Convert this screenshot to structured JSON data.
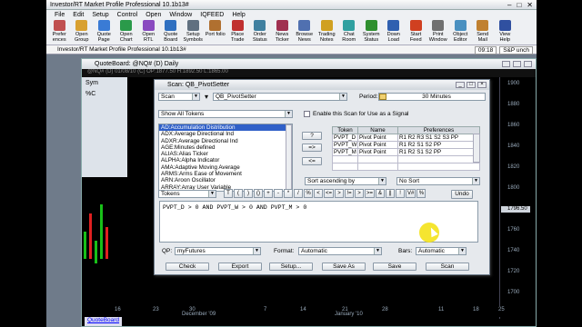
{
  "app": {
    "title": "Investor/RT Market Profile Professional 10.1b13#",
    "menu": [
      "File",
      "Edit",
      "Setup",
      "Control",
      "Open",
      "Window",
      "IQFEED",
      "Help"
    ],
    "toolbar": [
      {
        "label": "Prefer ences",
        "icon": "preferences-icon",
        "color": "#c05050"
      },
      {
        "label": "Open Group",
        "icon": "folder-icon",
        "color": "#d8a030"
      },
      {
        "label": "Quote Page",
        "icon": "quote-page-icon",
        "color": "#3a7bd5"
      },
      {
        "label": "Open Chart",
        "icon": "chart-icon",
        "color": "#2a9a4a"
      },
      {
        "label": "Open RTL",
        "icon": "rtl-icon",
        "color": "#8a4ac0"
      },
      {
        "label": "Quote Board",
        "icon": "quote-board-icon",
        "color": "#3070c0"
      },
      {
        "label": "Setup Symbols",
        "icon": "symbols-icon",
        "color": "#607080"
      },
      {
        "label": "Port folio",
        "icon": "portfolio-icon",
        "color": "#b07030"
      },
      {
        "label": "Place Trade",
        "icon": "trade-icon",
        "color": "#c03030"
      },
      {
        "label": "Order Status",
        "icon": "order-status-icon",
        "color": "#4080a0"
      },
      {
        "label": "News Ticker",
        "icon": "news-ticker-icon",
        "color": "#a03050"
      },
      {
        "label": "Browse News",
        "icon": "browse-news-icon",
        "color": "#5070b0"
      },
      {
        "label": "Trading Notes",
        "icon": "notes-icon",
        "color": "#d0a020"
      },
      {
        "label": "Chat Room",
        "icon": "chat-icon",
        "color": "#30a0a0"
      },
      {
        "label": "System Status",
        "icon": "system-status-icon",
        "color": "#2f8f2f"
      },
      {
        "label": "Down Load",
        "icon": "download-icon",
        "color": "#3060b0"
      },
      {
        "label": "Start Feed",
        "icon": "feed-icon",
        "color": "#d04020"
      },
      {
        "label": "Print Window",
        "icon": "print-icon",
        "color": "#707070"
      },
      {
        "label": "Object Editor",
        "icon": "object-editor-icon",
        "color": "#4a90c0"
      },
      {
        "label": "Send Mail",
        "icon": "mail-icon",
        "color": "#c08030"
      },
      {
        "label": "View Help",
        "icon": "help-icon",
        "color": "#3050a0"
      }
    ],
    "status": {
      "left": "Investor/RT Market Profile Professional 10.1b13#",
      "time": "09:18",
      "feed": "S&P unch"
    }
  },
  "quoteboard": {
    "title": "QuoteBoard: @NQ# (D) Daily",
    "info": "@NQ# (D) 01/08/10 (C) OP:1877.50 H:1892.50 L:1865.00",
    "tab": "QuoteBoard",
    "side_labels": [
      "Sym",
      "%C"
    ],
    "price_ticks": [
      "1900",
      "1880",
      "1860",
      "1840",
      "1820",
      "1800",
      "1780",
      "1760",
      "1740",
      "1720",
      "1700"
    ],
    "price_highlight": "1796.50",
    "x_ticks": [
      "16",
      "23",
      "30",
      "December '09",
      "7",
      "14",
      "21",
      "28",
      "January '10",
      "11",
      "18",
      "25"
    ]
  },
  "scan": {
    "title": "Scan: QB_PivotSetter",
    "type": "Scan",
    "name": "QB_PivotSetter",
    "period_label": "Period:",
    "period": "30 Minutes",
    "filter": "Show All Tokens",
    "enable_label": "Enable this Scan for Use as a Signal",
    "tokens": [
      "AD:Accumulation Distribution",
      "ADX:Average Directional Ind",
      "ADXR:Average Directional Ind",
      "AGE:Minutes defined",
      "ALIAS:Alias Ticker",
      "ALPHA:Alpha Indicator",
      "AMA:Adaptive Moving Average",
      "ARMS:Arms Ease of Movement",
      "ARN:Aroon Oscillator",
      "ARRAY:Array User Variable"
    ],
    "mid_buttons": [
      "?",
      "=>",
      "<="
    ],
    "table": {
      "headers": [
        "Token",
        "Name",
        "Preferences"
      ],
      "rows": [
        [
          "PVPT_D",
          "Pivot Point",
          "R1 R2 R3 S1 S2 S3 PP"
        ],
        [
          "PVPT_W",
          "Pivot Point",
          "R1 R2 S1 S2 PP"
        ],
        [
          "PVPT_M",
          "Pivot Point",
          "R1 R2 S1 S2 PP"
        ]
      ]
    },
    "sort_by": "Sort ascending by",
    "sort": "No Sort",
    "tokens_dropdown": "Tokens",
    "operators": [
      "T",
      "(",
      ")",
      "()",
      "+",
      "-",
      "*",
      "/",
      "%",
      "<",
      "<=",
      ">",
      "!=",
      ">",
      ">=",
      "&",
      "||",
      "!",
      "V#",
      "%"
    ],
    "undo": "Undo",
    "expression": "PVPT_D > 0 AND PVPT_W > 0 AND PVPT_M > 0",
    "qp_label": "QP:",
    "qp": "myFutures",
    "format_label": "Format:",
    "format": "Automatic",
    "bars_label": "Bars:",
    "bars": "Automatic",
    "buttons": [
      "Check",
      "Export",
      "Setup...",
      "Save As",
      "Save",
      "Scan"
    ]
  }
}
